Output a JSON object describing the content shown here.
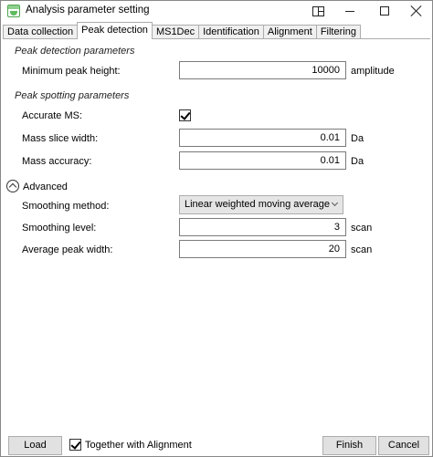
{
  "window": {
    "title": "Analysis parameter setting"
  },
  "tabs": [
    {
      "label": "Data collection",
      "active": false
    },
    {
      "label": "Peak detection",
      "active": true
    },
    {
      "label": "MS1Dec",
      "active": false
    },
    {
      "label": "Identification",
      "active": false
    },
    {
      "label": "Alignment",
      "active": false
    },
    {
      "label": "Filtering",
      "active": false
    }
  ],
  "peak_detection": {
    "section_title": "Peak detection parameters",
    "min_peak_height": {
      "label": "Minimum peak height:",
      "value": "10000",
      "unit": "amplitude"
    }
  },
  "peak_spotting": {
    "section_title": "Peak spotting parameters",
    "accurate_ms": {
      "label": "Accurate MS:",
      "checked": true
    },
    "mass_slice_width": {
      "label": "Mass slice width:",
      "value": "0.01",
      "unit": "Da"
    },
    "mass_accuracy": {
      "label": "Mass accuracy:",
      "value": "0.01",
      "unit": "Da"
    }
  },
  "advanced": {
    "label": "Advanced",
    "smoothing_method": {
      "label": "Smoothing method:",
      "value": "Linear weighted moving average"
    },
    "smoothing_level": {
      "label": "Smoothing level:",
      "value": "3",
      "unit": "scan"
    },
    "average_peak_width": {
      "label": "Average peak width:",
      "value": "20",
      "unit": "scan"
    }
  },
  "footer": {
    "load_label": "Load",
    "together_label": "Together with Alignment",
    "together_checked": true,
    "finish_label": "Finish",
    "cancel_label": "Cancel"
  }
}
